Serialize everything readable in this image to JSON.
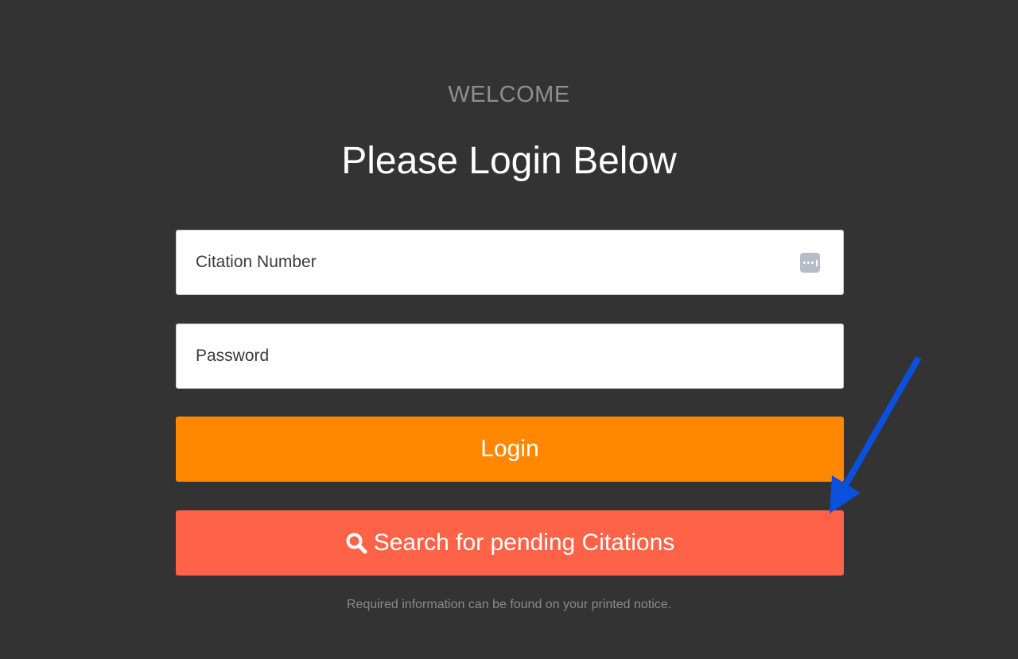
{
  "header": {
    "welcome": "WELCOME",
    "title": "Please Login Below"
  },
  "form": {
    "citation_placeholder": "Citation Number",
    "citation_value": "",
    "password_placeholder": "Password",
    "password_value": "",
    "login_label": "Login",
    "search_label": "Search for pending Citations",
    "note": "Required information can be found on your printed notice."
  },
  "icons": {
    "citation_field": "keychain-autofill-icon",
    "search_button": "search-icon",
    "annotation": "arrow-icon"
  },
  "colors": {
    "background": "#333333",
    "login_button": "#ff8800",
    "search_button": "#ff6347",
    "annotation_arrow": "#0a50dc"
  }
}
